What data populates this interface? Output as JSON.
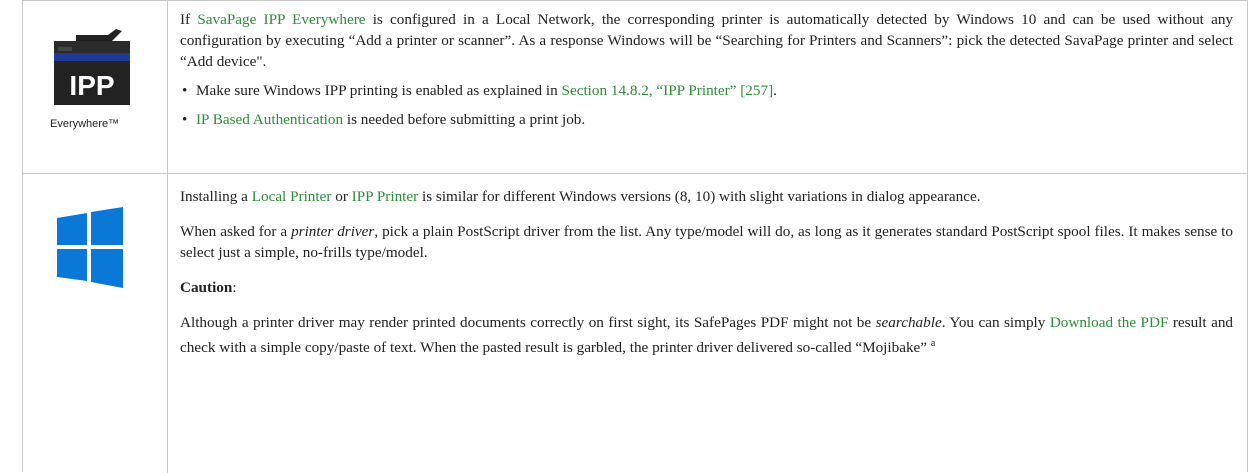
{
  "ipp": {
    "logo_text": "IPP",
    "logo_caption": "Everywhere™",
    "p1_pre": "If ",
    "p1_link": "SavaPage IPP Everywhere",
    "p1_post": " is configured in a Local Network, the corresponding printer is automatically detected by Windows 10 and can be used without any configuration by executing “Add a printer or scanner”. As a response Windows will be “Searching for Printers and Scanners”: pick the detected SavaPage printer and select “Add device\".",
    "bullet1_pre": "Make sure Windows IPP printing is enabled as explained in ",
    "bullet1_link": "Section 14.8.2, “IPP Printer” [257]",
    "bullet1_post": ".",
    "bullet2_link": "IP Based Authentication",
    "bullet2_post": " is needed before submitting a print job."
  },
  "windows": {
    "p1_pre": "Installing a ",
    "p1_link1": "Local Printer",
    "p1_mid": " or ",
    "p1_link2": "IPP Printer",
    "p1_post": " is similar for different Windows versions (8, 10) with slight variations in dialog appearance.",
    "p2_pre": "When asked for a ",
    "p2_em": "printer driver",
    "p2_post": ", pick a plain PostScript driver from the list. Any type/model will do, as long as it generates standard PostScript spool files. It makes sense to select just a simple, no-frills type/model.",
    "caution_label": "Caution",
    "caution_colon": ":",
    "p4_pre": "Although a printer driver may render printed documents correctly on first sight, its SafePages PDF might not be ",
    "p4_em": "searchable",
    "p4_mid": ". You can simply ",
    "p4_link": "Download the PDF",
    "p4_post": " result and check with a simple copy/paste of text. When the pasted result is garbled, the printer driver delivered so-called “Mojibake” ",
    "footnote_mark": "a"
  },
  "colors": {
    "link": "#2e8b3a",
    "ipp_blue": "#1f3a93",
    "ipp_dark": "#222222",
    "windows_blue": "#0a78d7",
    "border": "#c8c8c8"
  }
}
